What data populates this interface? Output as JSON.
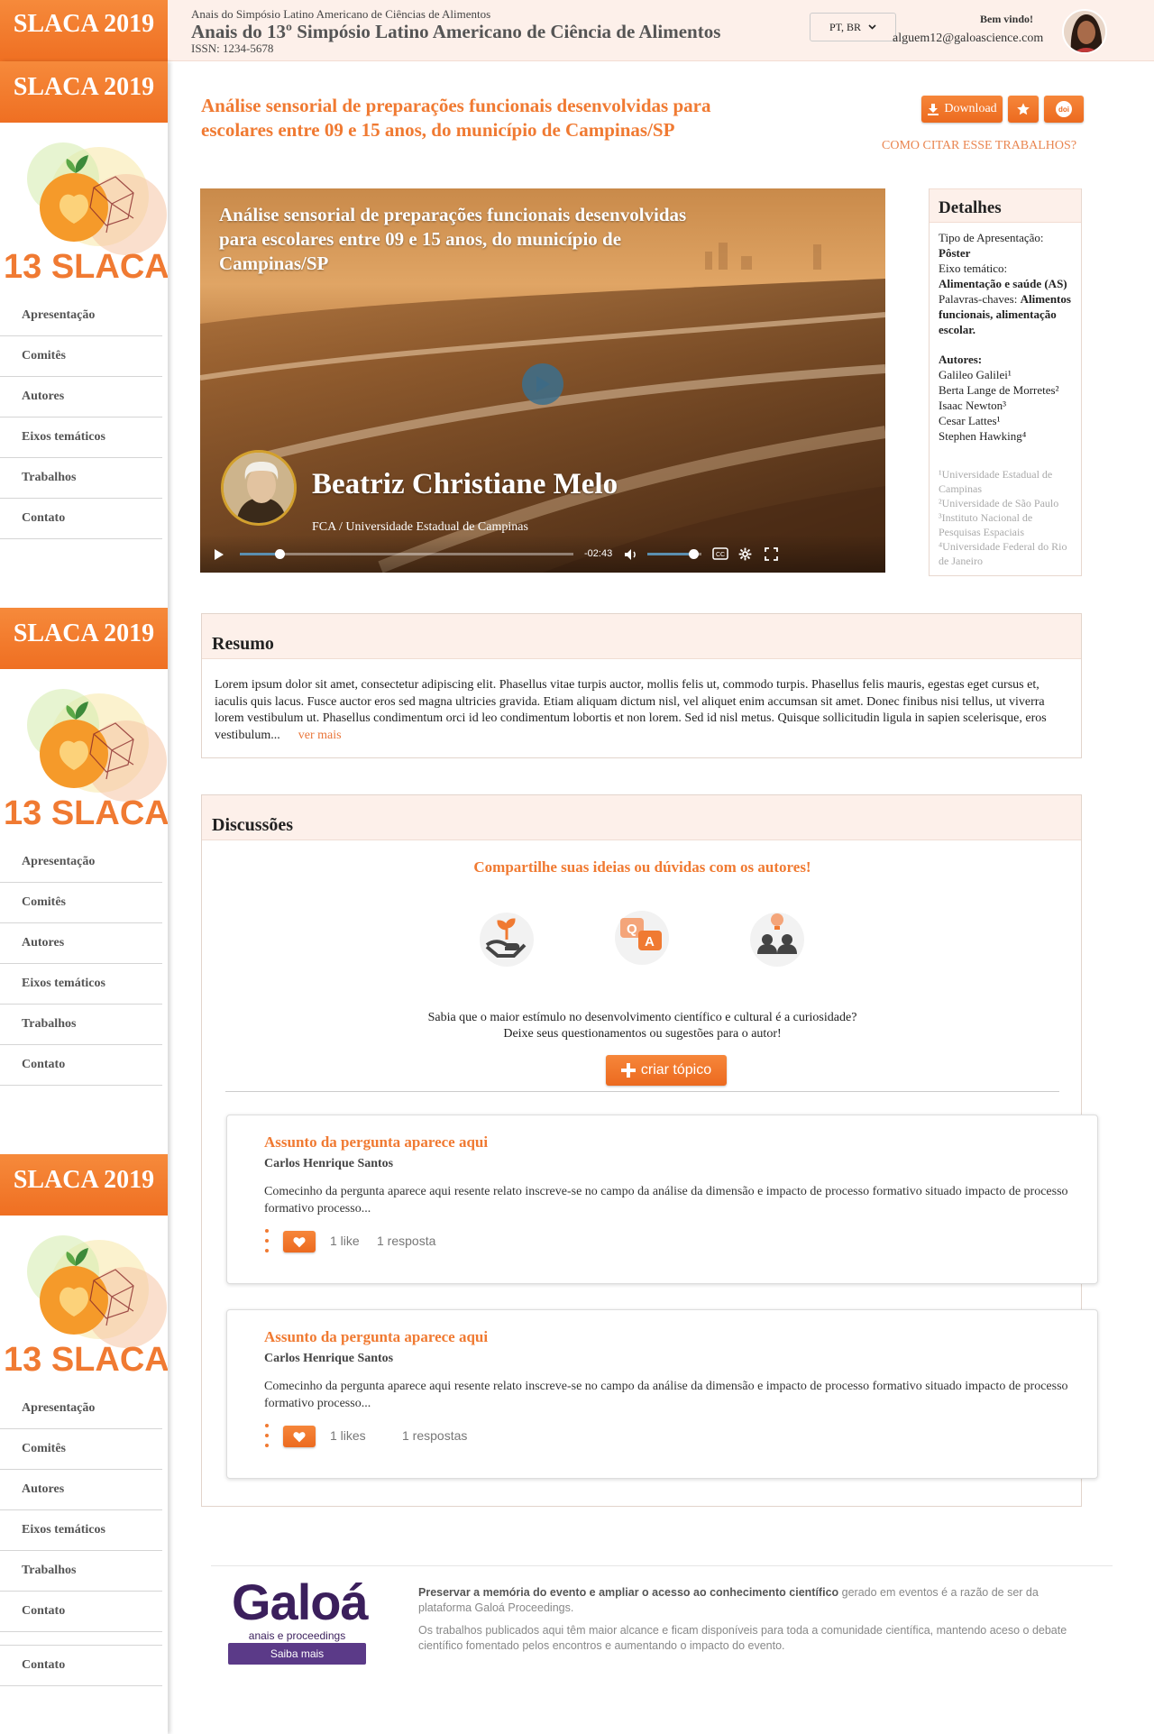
{
  "header": {
    "brand": "SLACA 2019",
    "event_small": "Anais do Simpósio Latino Americano de Ciências de Alimentos",
    "event_title": "Anais do 13º Simpósio Latino Americano de Ciência de Alimentos",
    "issn": "ISSN: 1234-5678",
    "language": "PT, BR",
    "welcome": "Bem vindo!",
    "email": "alguem12@galoascience.com"
  },
  "sidebar": {
    "brand": "SLACA 2019",
    "logo_text": "13 SLACA",
    "items": [
      "Apresentação",
      "Comitês",
      "Autores",
      "Eixos temáticos",
      "Trabalhos",
      "Contato"
    ],
    "bottom_item": "Contato"
  },
  "paper": {
    "title": "Análise sensorial de preparações funcionais desenvolvidas para escolares entre 09 e 15 anos, do município de Campinas/SP",
    "download_label": "Download",
    "doi_label": "doi",
    "cite_link": "COMO CITAR ESSE TRABALHOS?"
  },
  "video": {
    "title": "Análise sensorial de preparações funcionais desenvolvidas para escolares entre 09 e 15 anos, do município de Campinas/SP",
    "speaker": "Beatriz Christiane Melo",
    "affiliation": "FCA / Universidade Estadual de Campinas",
    "time_remaining": "-02:43",
    "progress": 0.12,
    "volume": 0.85
  },
  "details": {
    "heading": "Detalhes",
    "type_label": "Tipo de Apresentação:",
    "type_value": "Pôster",
    "axis_label": "Eixo temático:",
    "axis_value": "Alimentação e saúde (AS)",
    "keywords_label": "Palavras-chaves:",
    "keywords_value": "Alimentos funcionais, alimentação escolar.",
    "authors_label": "Autores:",
    "authors": [
      "Galileo Galilei¹",
      "Berta Lange de Morretes²",
      "Isaac Newton³",
      "Cesar Lattes¹",
      "Stephen Hawking⁴"
    ],
    "affiliations": [
      "¹Universidade Estadual de Campinas",
      "²Universidade de São Paulo",
      "³Instituto Nacional de Pesquisas Espaciais",
      "⁴Universidade Federal do Rio de Janeiro"
    ]
  },
  "resumo": {
    "heading": "Resumo",
    "text": "Lorem ipsum dolor sit amet, consectetur adipiscing elit. Phasellus vitae turpis auctor, mollis felis ut, commodo turpis. Phasellus felis mauris, egestas eget cursus et, iaculis quis lacus. Fusce auctor eros sed magna ultricies gravida. Etiam aliquam dictum nisl, vel aliquet enim accumsan sit amet. Donec finibus nisi tellus, ut viverra lorem vestibulum ut. Phasellus condimentum orci id leo condimentum lobortis et non lorem. Sed id nisl metus. Quisque sollicitudin ligula in sapien scelerisque, eros vestibulum...",
    "more": "ver mais"
  },
  "discussions": {
    "heading": "Discussões",
    "cta": "Compartilhe suas ideias ou dúvidas com os autores!",
    "line1": "Sabia que o maior estímulo no desenvolvimento científico e cultural é a curiosidade?",
    "line2": "Deixe seus questionamentos ou sugestões para o autor!",
    "create_label": "criar tópico",
    "topics": [
      {
        "title": "Assunto da pergunta aparece aqui",
        "author": "Carlos Henrique Santos",
        "body": "Comecinho da pergunta aparece aqui resente relato inscreve-se no campo da análise da dimensão e impacto de processo formativo situado impacto de processo formativo processo...",
        "likes": "1 like",
        "replies": "1 resposta"
      },
      {
        "title": "Assunto da pergunta aparece aqui",
        "author": "Carlos Henrique Santos",
        "body": "Comecinho da pergunta aparece aqui resente relato inscreve-se no campo da análise da dimensão e impacto de processo formativo situado impacto de processo formativo processo...",
        "likes": "1 likes",
        "replies": "1 respostas"
      }
    ]
  },
  "footer": {
    "logo": "Galoá",
    "logo_sub": "anais e proceedings",
    "logo_button": "Saiba mais",
    "bold": "Preservar a memória do evento e ampliar o acesso ao conhecimento científico",
    "text1": " gerado em eventos é a razão de ser da plataforma Galoá Proceedings.",
    "text2": "Os trabalhos publicados aqui têm maior alcance e ficam disponíveis para toda a comunidade científica, mantendo aceso o debate científico fomentado pelos encontros e aumentando o impacto do evento."
  },
  "colors": {
    "accent": "#f47b2a",
    "cream": "#fdf0ea",
    "galoa_purple": "#3b1f5c"
  }
}
